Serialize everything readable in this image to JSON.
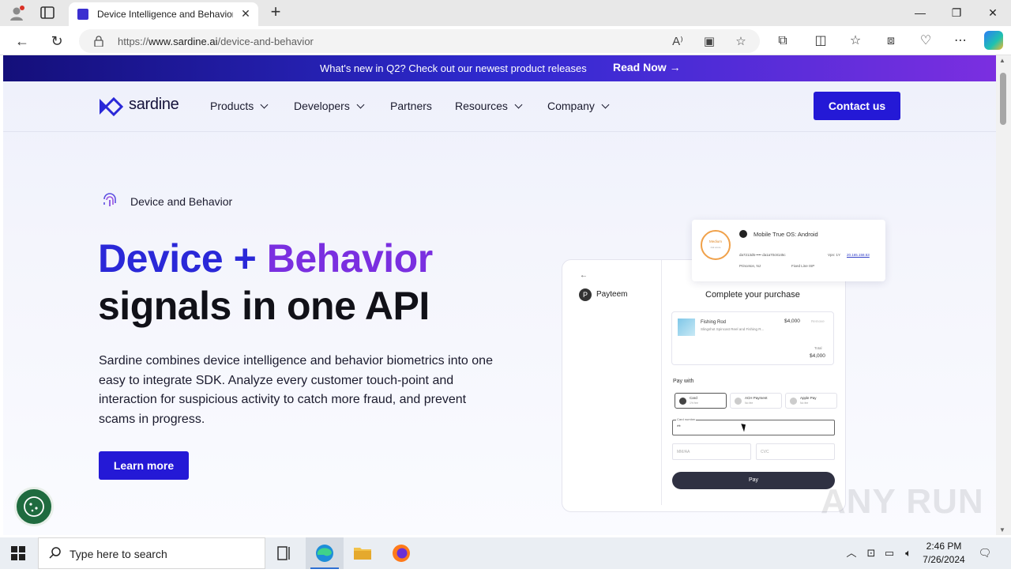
{
  "browser": {
    "tab": {
      "title": "Device Intelligence and Behavior"
    },
    "url": {
      "prefix": "https://",
      "host": "www.sardine.ai",
      "path": "/device-and-behavior"
    }
  },
  "banner": {
    "text": "What's new in Q2? Check out our newest product releases",
    "link": "Read Now →"
  },
  "nav": {
    "logo": "sardine",
    "items": [
      {
        "label": "Products"
      },
      {
        "label": "Developers"
      },
      {
        "label": "Partners"
      },
      {
        "label": "Resources"
      },
      {
        "label": "Company"
      }
    ],
    "cta": "Contact us"
  },
  "hero": {
    "eyebrow": "Device and Behavior",
    "title_part1": "Device + ",
    "title_part2": "Behavior",
    "title_line2": "signals in one API",
    "lede": "Sardine combines device intelligence and behavior biometrics into one easy to integrate SDK. Analyze every customer touch-point and interaction for suspicious activity to catch more fraud, and prevent scams in progress.",
    "button": "Learn more"
  },
  "illustration": {
    "signal_card": {
      "risk_label": "Medium",
      "risk_sub": "risk score",
      "os": "Mobile True OS: Android",
      "device_id": "da7213d5-••••  da1a70c8145c",
      "vpn_label": "Vpn: 1Y",
      "ip": "20.165.158.53",
      "location": "Princeton, NJ",
      "isp": "Fixed Line ISP"
    },
    "checkout": {
      "back": "←",
      "merchant_initial": "P",
      "merchant": "Payteem",
      "title": "Complete your purchase",
      "item_name": "Fishing Rod",
      "item_sub": "Slingshot Spincast Reel and Fishing R...",
      "price": "$4,000",
      "remove": "Remove",
      "total_label": "Total",
      "total": "$4,000",
      "pay_with": "Pay with",
      "options": [
        {
          "name": "Card",
          "sub": "1% fee"
        },
        {
          "name": "ACH Payment",
          "sub": "No fee"
        },
        {
          "name": "Apple Pay",
          "sub": "No fee"
        }
      ],
      "card_label": "Card number",
      "card_value": "**",
      "mmaa": "MM/AA",
      "cvc": "CVC",
      "pay": "Pay"
    }
  },
  "watermark": "ANY RUN",
  "taskbar": {
    "search_placeholder": "Type here to search",
    "time": "2:46 PM",
    "date": "7/26/2024"
  },
  "colors": {
    "brand_primary": "#2419d6",
    "gradient_purple": "#7a2fe0",
    "banner_dark": "#140f7a"
  }
}
